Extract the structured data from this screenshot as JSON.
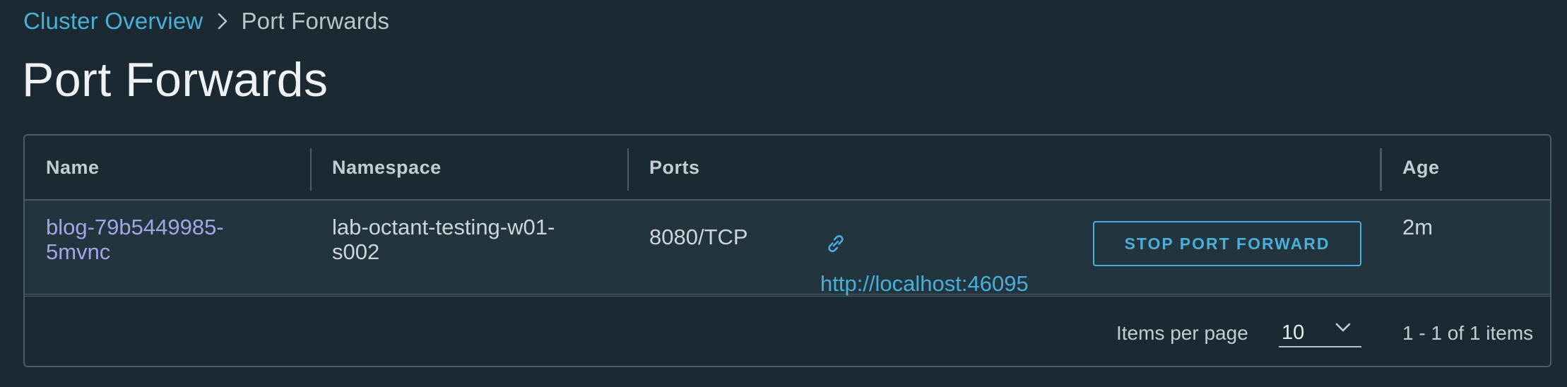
{
  "breadcrumb": {
    "parent": "Cluster Overview",
    "current": "Port Forwards"
  },
  "page": {
    "title": "Port Forwards"
  },
  "table": {
    "columns": [
      "Name",
      "Namespace",
      "Ports",
      "Age"
    ],
    "rows": [
      {
        "name_line1": "blog-79b5449985-",
        "name_line2": "5mvnc",
        "namespace_line1": "lab-octant-testing-w01-",
        "namespace_line2": "s002",
        "ports": "8080/TCP",
        "url": "http://localhost:46095",
        "action_label": "STOP PORT FORWARD",
        "age": "2m"
      }
    ]
  },
  "pagination": {
    "items_per_page_label": "Items per page",
    "items_per_page_value": "10",
    "range_text": "1 - 1 of 1 items"
  },
  "icons": {
    "separator": "chevron-right-icon",
    "link": "link-icon",
    "dropdown": "chevron-down-icon"
  },
  "colors": {
    "background": "#1b2a32",
    "row_background": "#22343e",
    "accent": "#49afd9",
    "name_link": "#a3a6e5",
    "border": "#485b66"
  }
}
